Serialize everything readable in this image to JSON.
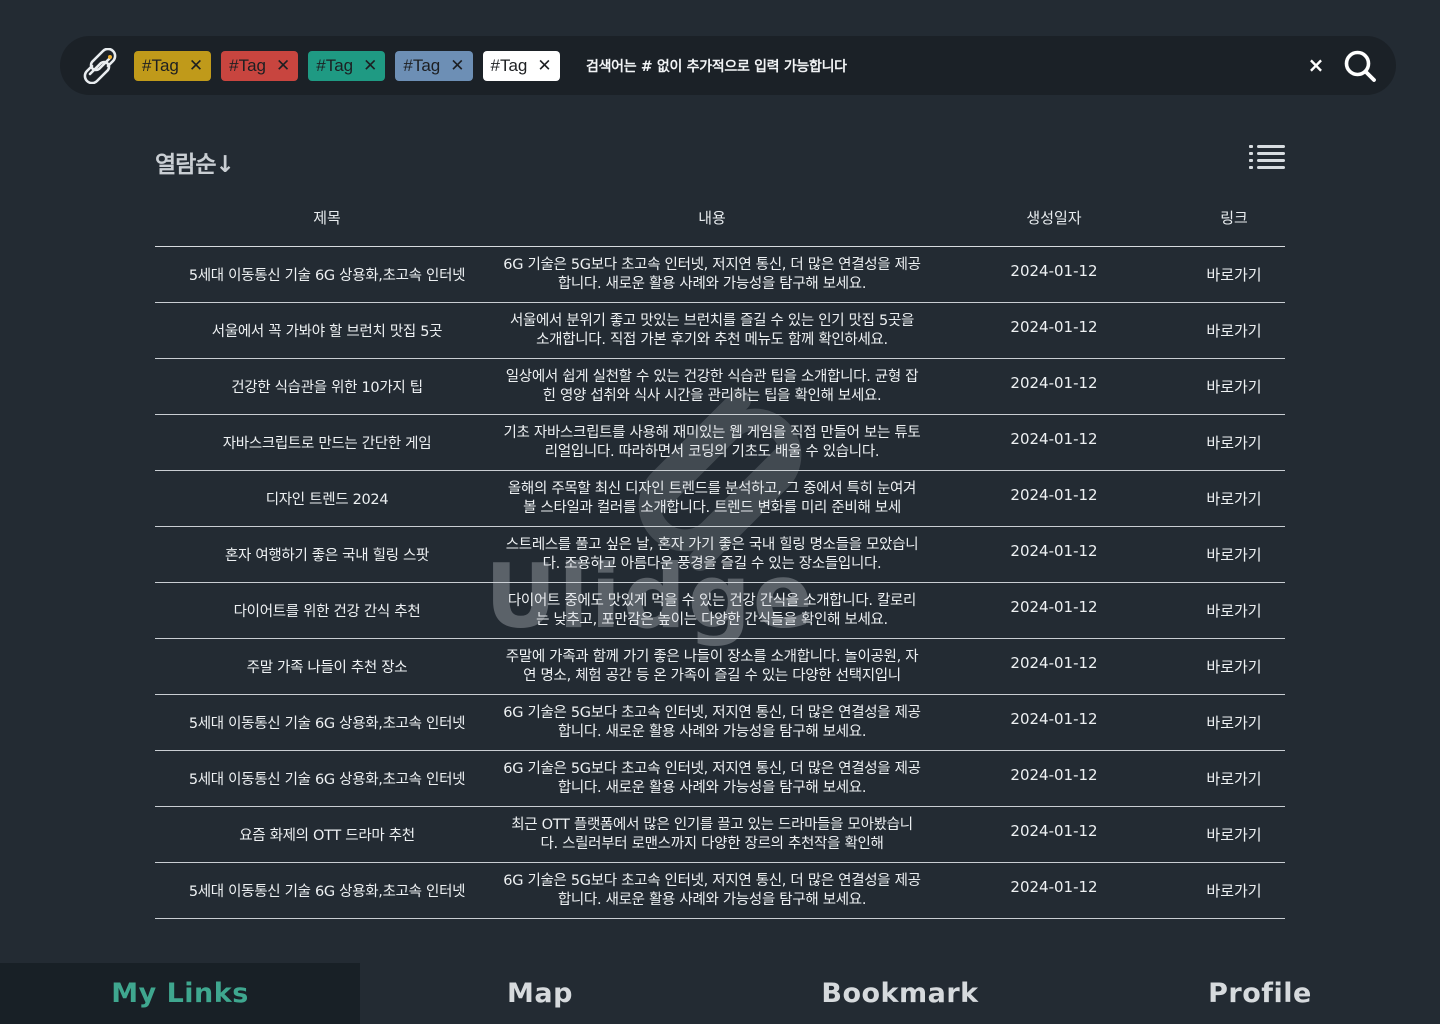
{
  "search": {
    "tags": [
      {
        "label": "#Tag",
        "color": "#c09a1a"
      },
      {
        "label": "#Tag",
        "color": "#c8453f"
      },
      {
        "label": "#Tag",
        "color": "#1f9a83"
      },
      {
        "label": "#Tag",
        "color": "#6d8fb5"
      },
      {
        "label": "#Tag",
        "color": "#ffffff"
      }
    ],
    "remove_symbol": "✕",
    "hint": "검색어는 # 없이 추가적으로 입력 가능합니다",
    "clear_symbol": "×"
  },
  "sort": {
    "label": "열람순↓"
  },
  "table": {
    "headers": {
      "title": "제목",
      "content": "내용",
      "date": "생성일자",
      "link": "링크"
    },
    "rows": [
      {
        "title": "5세대 이동통신 기술 6G 상용화,초고속 인터넷",
        "content": "6G 기술은 5G보다 초고속 인터넷, 저지연 통신, 더 많은 연결성을 제공합니다. 새로운 활용 사례와 가능성을 탐구해 보세요.",
        "date": "2024-01-12",
        "link": "바로가기"
      },
      {
        "title": "서울에서 꼭 가봐야 할 브런치 맛집 5곳",
        "content": "서울에서 분위기 좋고 맛있는 브런치를 즐길 수 있는 인기 맛집 5곳을 소개합니다. 직접 가본 후기와 추천 메뉴도 함께 확인하세요.",
        "date": "2024-01-12",
        "link": "바로가기"
      },
      {
        "title": "건강한 식습관을 위한 10가지 팁",
        "content": "일상에서 쉽게 실천할 수 있는 건강한 식습관 팁을 소개합니다. 균형 잡힌 영양 섭취와 식사 시간을 관리하는 팁을 확인해 보세요.",
        "date": "2024-01-12",
        "link": "바로가기"
      },
      {
        "title": "자바스크립트로 만드는 간단한 게임",
        "content": "기초 자바스크립트를 사용해 재미있는 웹 게임을 직접 만들어 보는 튜토리얼입니다. 따라하면서 코딩의 기초도 배울 수 있습니다.",
        "date": "2024-01-12",
        "link": "바로가기"
      },
      {
        "title": "디자인 트렌드 2024",
        "content": "올해의 주목할 최신 디자인 트렌드를 분석하고, 그 중에서 특히 눈여겨볼 스타일과 컬러를 소개합니다. 트렌드 변화를 미리 준비해 보세",
        "date": "2024-01-12",
        "link": "바로가기"
      },
      {
        "title": "혼자 여행하기 좋은 국내 힐링 스팟",
        "content": "스트레스를 풀고 싶은 날, 혼자 가기 좋은 국내 힐링 명소들을 모았습니다. 조용하고 아름다운 풍경을 즐길 수 있는 장소들입니다.",
        "date": "2024-01-12",
        "link": "바로가기"
      },
      {
        "title": "다이어트를 위한 건강 간식 추천",
        "content": "다이어트 중에도 맛있게 먹을 수 있는 건강 간식을 소개합니다. 칼로리는 낮추고, 포만감은 높이는 다양한 간식들을 확인해 보세요.",
        "date": "2024-01-12",
        "link": "바로가기"
      },
      {
        "title": "주말 가족 나들이 추천 장소",
        "content": "주말에 가족과 함께 가기 좋은 나들이 장소를 소개합니다. 놀이공원, 자연 명소, 체험 공간 등 온 가족이 즐길 수 있는 다양한 선택지입니",
        "date": "2024-01-12",
        "link": "바로가기"
      },
      {
        "title": "5세대 이동통신 기술 6G 상용화,초고속 인터넷",
        "content": "6G 기술은 5G보다 초고속 인터넷, 저지연 통신, 더 많은 연결성을 제공합니다. 새로운 활용 사례와 가능성을 탐구해 보세요.",
        "date": "2024-01-12",
        "link": "바로가기"
      },
      {
        "title": "5세대 이동통신 기술 6G 상용화,초고속 인터넷",
        "content": "6G 기술은 5G보다 초고속 인터넷, 저지연 통신, 더 많은 연결성을 제공합니다. 새로운 활용 사례와 가능성을 탐구해 보세요.",
        "date": "2024-01-12",
        "link": "바로가기"
      },
      {
        "title": "요즘 화제의 OTT 드라마 추천",
        "content": "최근 OTT 플랫폼에서 많은 인기를 끌고 있는 드라마들을 모아봤습니다. 스릴러부터 로맨스까지 다양한 장르의 추천작을 확인해",
        "date": "2024-01-12",
        "link": "바로가기"
      },
      {
        "title": "5세대 이동통신 기술 6G 상용화,초고속 인터넷",
        "content": "6G 기술은 5G보다 초고속 인터넷, 저지연 통신, 더 많은 연결성을 제공합니다. 새로운 활용 사례와 가능성을 탐구해 보세요.",
        "date": "2024-01-12",
        "link": "바로가기"
      }
    ]
  },
  "watermark": {
    "text": "Ulidge"
  },
  "nav": {
    "items": [
      {
        "label": "My Links",
        "active": true
      },
      {
        "label": "Map",
        "active": false
      },
      {
        "label": "Bookmark",
        "active": false
      },
      {
        "label": "Profile",
        "active": false
      }
    ],
    "active_color": "#3fa78f"
  }
}
